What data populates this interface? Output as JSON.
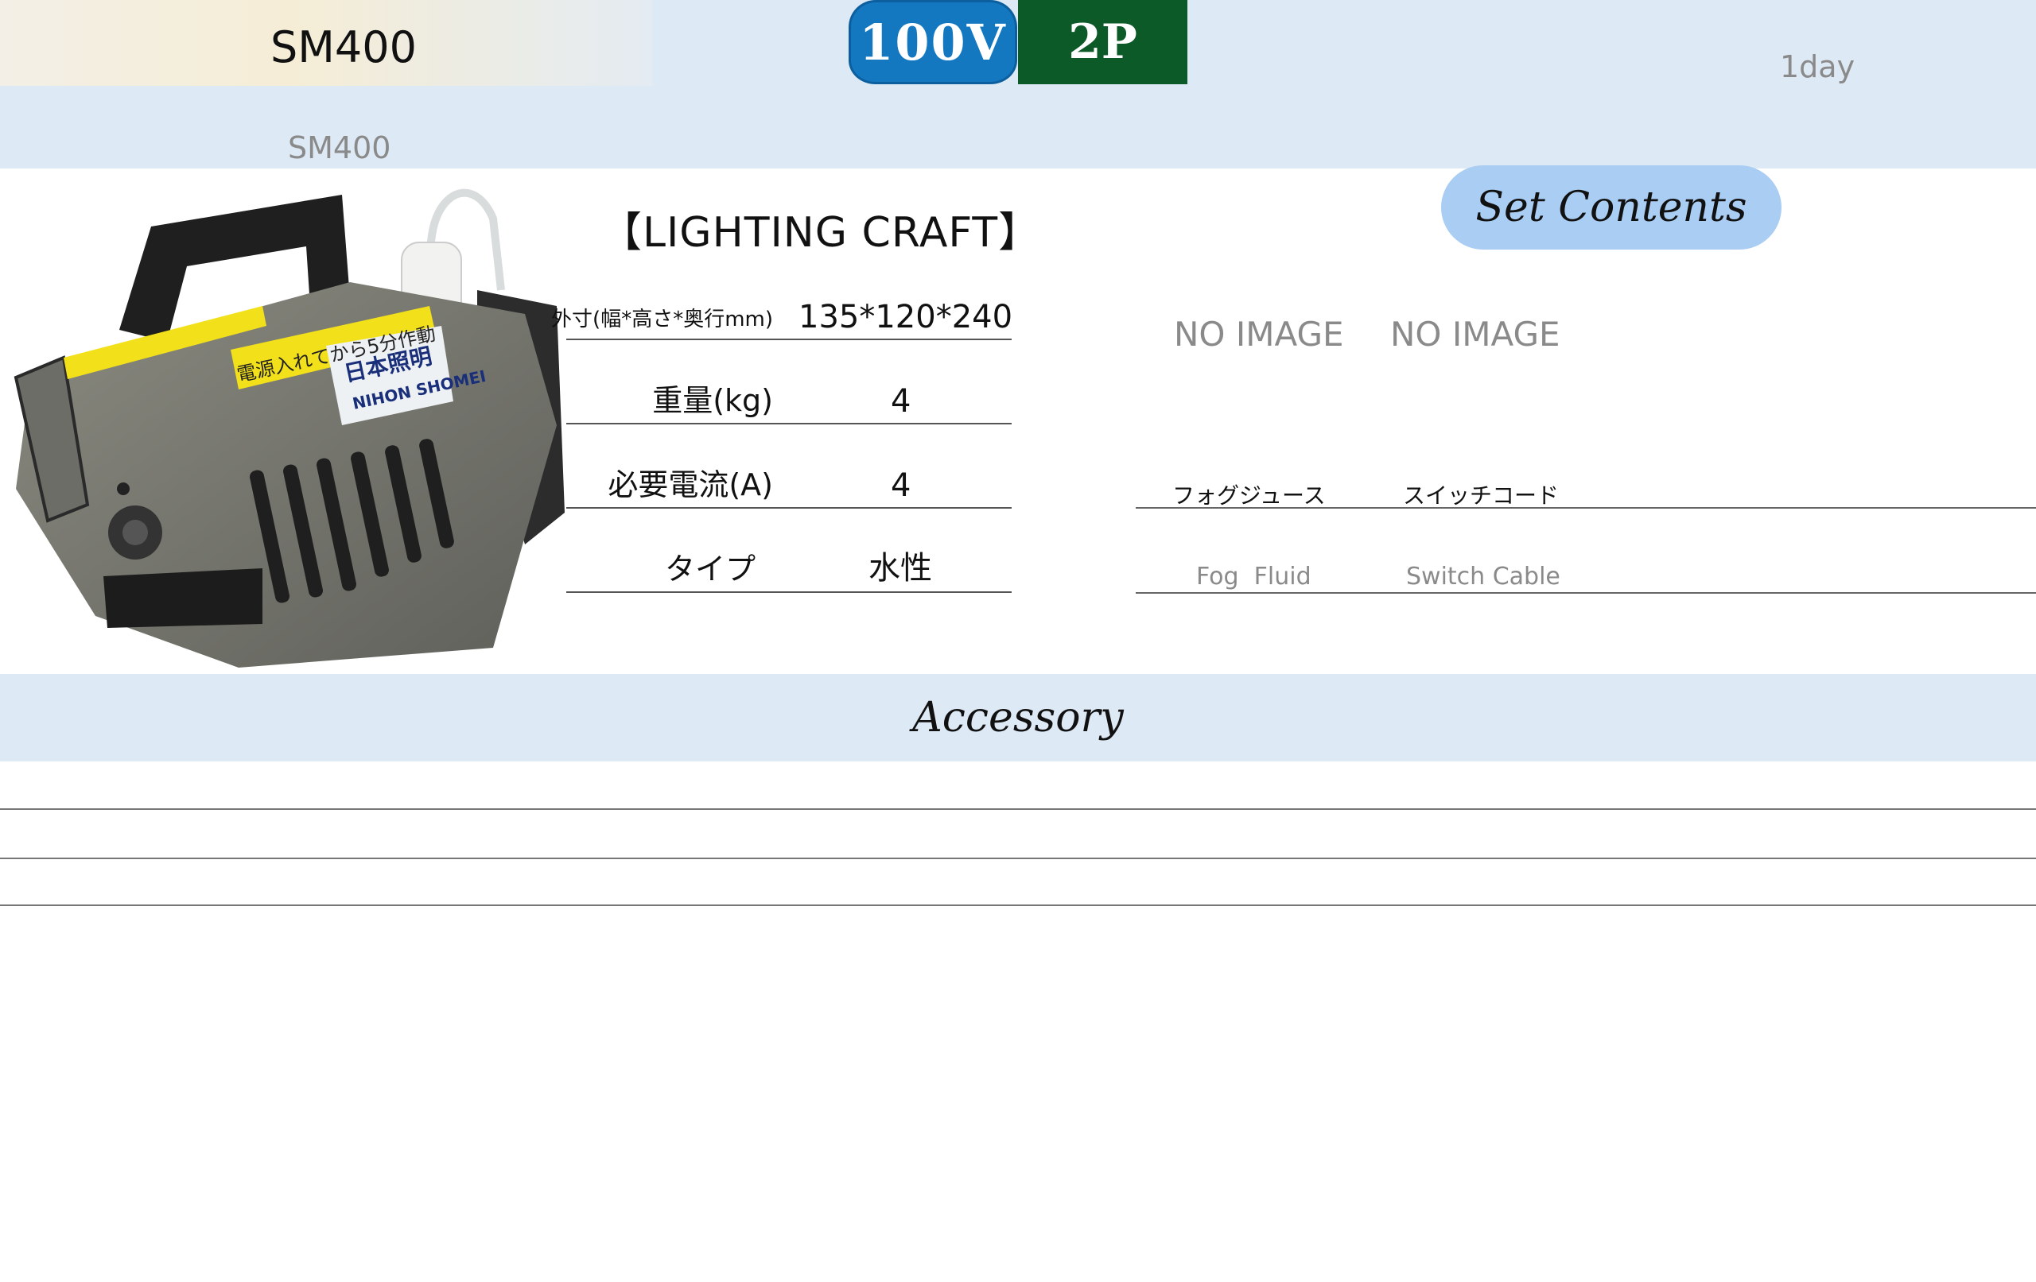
{
  "header": {
    "model_title": "SM400",
    "model_subtitle": "SM400",
    "voltage_badge": "100V",
    "pin_badge": "2P",
    "rental_term": "1day",
    "colors": {
      "band": "#dde9f5",
      "voltage": "#1478c0",
      "pin": "#0c5a28"
    }
  },
  "product": {
    "brand": "【LIGHTING CRAFT】",
    "photo_label_jp": "電源入れてから5分作動",
    "photo_logo_jp": "日本照明",
    "photo_logo_en": "NIHON SHOMEI",
    "specs": [
      {
        "label": "外寸(幅*高さ*奥行mm)",
        "value": "135*120*240"
      },
      {
        "label": "重量(kg)",
        "value": "4"
      },
      {
        "label": "必要電流(A)",
        "value": "4"
      },
      {
        "label": "タイプ",
        "value": "水性"
      }
    ]
  },
  "set_contents": {
    "title": "Set Contents",
    "items": [
      {
        "image": "NO IMAGE",
        "name_jp": "フォグジュース",
        "name_en": "Fog  Fluid"
      },
      {
        "image": "NO IMAGE",
        "name_jp": "スイッチコード",
        "name_en": "Switch Cable"
      }
    ]
  },
  "accessory": {
    "title": "Accessory"
  }
}
